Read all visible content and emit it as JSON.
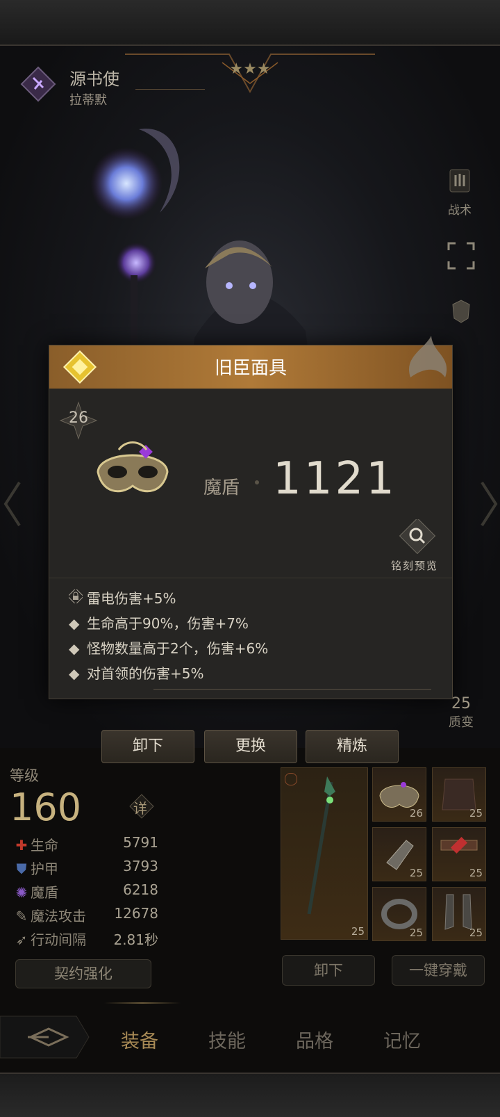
{
  "character": {
    "class_name": "源书使",
    "name": "拉蒂默"
  },
  "side_buttons": {
    "tactics_label": "战术",
    "mutation_count": "25",
    "mutation_label": "质变"
  },
  "item_popup": {
    "title": "旧臣面具",
    "level": "26",
    "stat_label": "魔盾",
    "stat_value": "1121",
    "engrave_preview_label": "铭刻预览",
    "affixes": [
      {
        "icon": "lock-icon",
        "text": "雷电伤害+5%"
      },
      {
        "icon": "diamond-bullet-icon",
        "text": "生命高于90%，伤害+7%"
      },
      {
        "icon": "diamond-bullet-icon",
        "text": "怪物数量高于2个，伤害+6%"
      },
      {
        "icon": "diamond-bullet-icon",
        "text": "对首领的伤害+5%"
      }
    ]
  },
  "actions": {
    "unequip": "卸下",
    "replace": "更换",
    "refine": "精炼"
  },
  "stats": {
    "level_label": "等级",
    "level_value": "160",
    "detail_label": "详",
    "rows": [
      {
        "icon": "health-cross-icon",
        "label": "生命",
        "value": "5791"
      },
      {
        "icon": "armor-shield-icon",
        "label": "护甲",
        "value": "3793"
      },
      {
        "icon": "magic-shield-icon",
        "label": "魔盾",
        "value": "6218"
      },
      {
        "icon": "magic-attack-icon",
        "label": "魔法攻击",
        "value": "12678"
      },
      {
        "icon": "action-interval-icon",
        "label": "行动间隔",
        "value": "2.81秒"
      }
    ],
    "contract_button": "契约强化"
  },
  "equipment": {
    "weapon_level": "25",
    "slots": [
      "26",
      "25",
      "25",
      "25",
      "25",
      "25"
    ],
    "unequip_button": "卸下",
    "equip_all_button": "一键穿戴"
  },
  "tabs": [
    "装备",
    "技能",
    "品格",
    "记忆"
  ],
  "colors": {
    "accent_gold": "#b07a38",
    "active_tab": "#a88a55"
  }
}
